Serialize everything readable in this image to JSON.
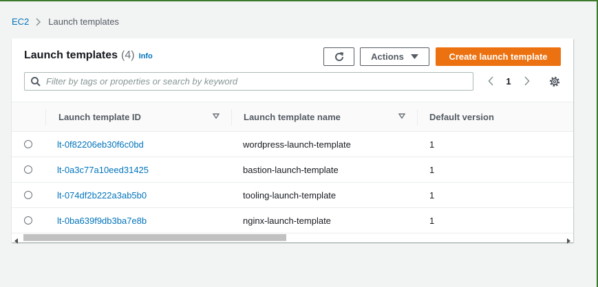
{
  "breadcrumb": {
    "root": "EC2",
    "current": "Launch templates"
  },
  "panel": {
    "title": "Launch templates",
    "count": "(4)",
    "info": "Info",
    "actions_label": "Actions",
    "create_label": "Create launch template"
  },
  "search": {
    "placeholder": "Filter by tags or properties or search by keyword",
    "value": ""
  },
  "pagination": {
    "current_page": "1"
  },
  "table": {
    "columns": [
      "Launch template ID",
      "Launch template name",
      "Default version"
    ],
    "rows": [
      {
        "id": "lt-0f82206eb30f6c0bd",
        "name": "wordpress-launch-template",
        "version": "1"
      },
      {
        "id": "lt-0a3c77a10eed31425",
        "name": "bastion-launch-template",
        "version": "1"
      },
      {
        "id": "lt-074df2b222a3ab5b0",
        "name": "tooling-launch-template",
        "version": "1"
      },
      {
        "id": "lt-0ba639f9db3ba7e8b",
        "name": "nginx-launch-template",
        "version": "1"
      }
    ]
  },
  "colors": {
    "link": "#0073bb",
    "primary": "#ec7211",
    "background": "#f2f3f3"
  }
}
